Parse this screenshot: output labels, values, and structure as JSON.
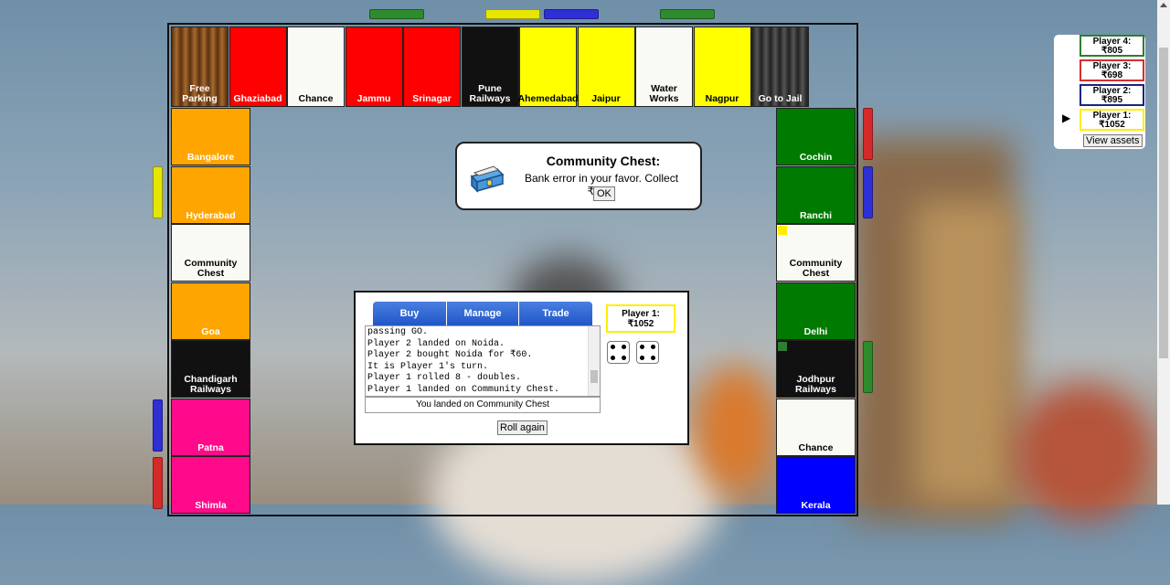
{
  "board": {
    "top_row": [
      {
        "name": "Free Parking",
        "color": "#7a4a1e"
      },
      {
        "name": "Ghaziabad",
        "color": "#ff0000"
      },
      {
        "name": "Chance",
        "color": "#fafaf5"
      },
      {
        "name": "Jammu",
        "color": "#ff0000"
      },
      {
        "name": "Srinagar",
        "color": "#ff0000"
      },
      {
        "name": "Pune Railways",
        "color": "#111111"
      },
      {
        "name": "Ahemedabad",
        "color": "#ffff00"
      },
      {
        "name": "Jaipur",
        "color": "#ffff00"
      },
      {
        "name": "Water Works",
        "color": "#fafaf5"
      },
      {
        "name": "Nagpur",
        "color": "#ffff00"
      },
      {
        "name": "Go to Jail",
        "color": "#333333"
      }
    ],
    "left_column": [
      {
        "name": "Bangalore",
        "color": "#ffa500"
      },
      {
        "name": "Hyderabad",
        "color": "#ffa500"
      },
      {
        "name": "Community Chest",
        "color": "#fafaf5"
      },
      {
        "name": "Goa",
        "color": "#ffa500"
      },
      {
        "name": "Chandigarh Railways",
        "color": "#111111"
      },
      {
        "name": "Patna",
        "color": "#ff0a8a"
      },
      {
        "name": "Shimla",
        "color": "#ff0a8a"
      }
    ],
    "right_column": [
      {
        "name": "Cochin",
        "color": "#007a00"
      },
      {
        "name": "Ranchi",
        "color": "#007a00"
      },
      {
        "name": "Community Chest",
        "color": "#fafaf5"
      },
      {
        "name": "Delhi",
        "color": "#007a00"
      },
      {
        "name": "Jodhpur Railways",
        "color": "#111111"
      },
      {
        "name": "Chance",
        "color": "#fafaf5"
      },
      {
        "name": "Kerala",
        "color": "#0000ff"
      }
    ]
  },
  "popup": {
    "title": "Community Chest:",
    "message": "Bank error in your favor. Collect ₹200.",
    "ok_label": "OK"
  },
  "control": {
    "tabs": [
      "Buy",
      "Manage",
      "Trade"
    ],
    "log": [
      "passing GO.",
      "Player 2 landed on Noida.",
      "Player 2 bought Noida for ₹60.",
      "It is Player 1's turn.",
      "Player 1 rolled 8 - doubles.",
      "Player 1 landed on Community Chest."
    ],
    "landed": "You landed on Community Chest",
    "roll_label": "Roll again",
    "current_player_name": "Player 1:",
    "current_player_money": "₹1052",
    "dice": [
      4,
      4
    ]
  },
  "players": [
    {
      "name": "Player 4:",
      "money": "₹805",
      "color": "#2e7d32"
    },
    {
      "name": "Player 3:",
      "money": "₹698",
      "color": "#d32f2f"
    },
    {
      "name": "Player 2:",
      "money": "₹895",
      "color": "#1a237e"
    },
    {
      "name": "Player 1:",
      "money": "₹1052",
      "color": "#ffee00"
    }
  ],
  "current_player_index": 3,
  "view_assets_label": "View assets"
}
